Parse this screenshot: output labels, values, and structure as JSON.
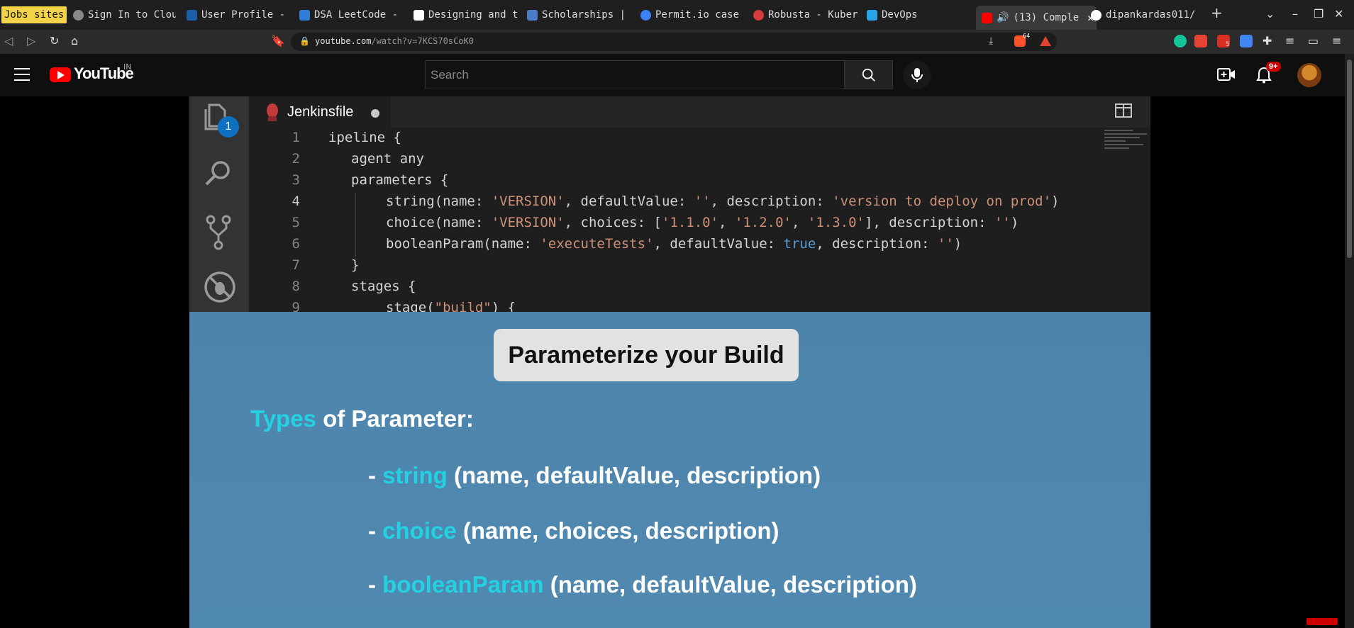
{
  "browser": {
    "tabs": [
      {
        "label": "Jobs sites"
      },
      {
        "label": "Sign In to Clou"
      },
      {
        "label": "User Profile -"
      },
      {
        "label": "DSA LeetCode -"
      },
      {
        "label": "Designing and t"
      },
      {
        "label": "Scholarships |"
      },
      {
        "label": "Permit.io case"
      },
      {
        "label": "Robusta - Kuber"
      },
      {
        "label": "DevOps"
      },
      {
        "label": "(13) Comple"
      },
      {
        "label": "dipankardas011/"
      }
    ],
    "url_host": "youtube.com",
    "url_path": "/watch?v=7KCS70sCoK0",
    "brave_count": "64",
    "ext_badge": "5"
  },
  "youtube": {
    "logo": "YouTube",
    "country": "IN",
    "search_placeholder": "Search",
    "notifications": "9+"
  },
  "editor": {
    "file_tab": "Jenkinsfile",
    "explorer_badge": "1",
    "line_numbers": [
      "1",
      "2",
      "3",
      "4",
      "5",
      "6",
      "7",
      "8",
      "9"
    ]
  },
  "slide": {
    "title": "Parameterize your Build",
    "types_highlight": "Types",
    "types_rest": " of Parameter:",
    "bullets": [
      {
        "dash": "- ",
        "name": "string",
        "args": " (name, defaultValue, description)"
      },
      {
        "dash": "- ",
        "name": "choice",
        "args": " (name, choices, description)"
      },
      {
        "dash": "- ",
        "name": "booleanParam",
        "args": " (name, defaultValue, description)"
      }
    ]
  },
  "colors": {
    "slide_bg": "#4f86ad",
    "keyword_cyan": "#23d1e3",
    "yt_red": "#ff0000",
    "code_string": "#ce9178",
    "code_keyword": "#569cd6"
  }
}
